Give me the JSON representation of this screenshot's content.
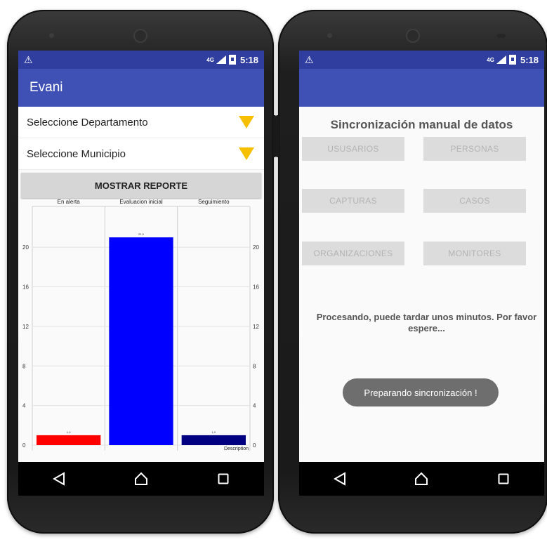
{
  "left": {
    "status": {
      "warning_icon": "⚠",
      "network": "4G",
      "time": "5:18"
    },
    "app_title": "Evani",
    "departamento_label": "Seleccione Departamento",
    "municipio_label": "Seleccione Municipio",
    "report_button": "MOSTRAR REPORTE"
  },
  "chart_data": {
    "type": "bar",
    "categories": [
      "En alerta",
      "Evaluacion inicial",
      "Seguimiento"
    ],
    "values": [
      1,
      21,
      1
    ],
    "value_labels": [
      "1,0",
      "21,0",
      "1,0"
    ],
    "colors": [
      "#ff0000",
      "#0000ff",
      "#000080"
    ],
    "ylim": [
      0,
      22
    ],
    "yticks": [
      0,
      4,
      8,
      12,
      16,
      20
    ],
    "legend": "Description",
    "grid": true
  },
  "right": {
    "status": {
      "warning_icon": "⚠",
      "network": "4G",
      "time": "5:18"
    },
    "title": "Sincronización manual de datos",
    "buttons": [
      "USUSARIOS",
      "PERSONAS",
      "CAPTURAS",
      "CASOS",
      "ORGANIZACIONES",
      "MONITORES"
    ],
    "processing_text": "Procesando, puede tardar unos minutos. Por favor espere...",
    "toast_text": "Preparando sincronización !"
  },
  "icons": {
    "back": "back-triangle-icon",
    "home": "home-icon",
    "recent": "recent-apps-icon",
    "dropdown": "dropdown-triangle-icon"
  }
}
